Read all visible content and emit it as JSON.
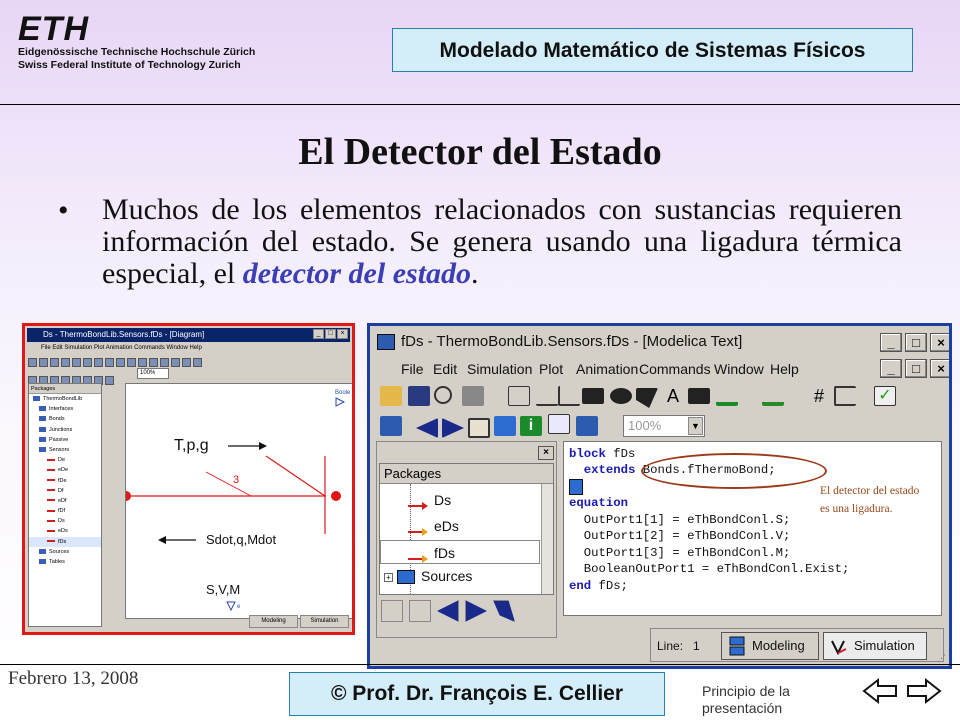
{
  "header": {
    "logo_text": "ETH",
    "logo_line1": "Eidgenössische Technische Hochschule Zürich",
    "logo_line2": "Swiss Federal Institute of Technology Zurich",
    "course_title": "Modelado Matemático de Sistemas Físicos"
  },
  "slide": {
    "title": "El Detector del Estado",
    "bullet": "•",
    "text_before": "Muchos de los elementos relacionados con sustancias requieren información del estado.  Se genera usando una ligadura térmica especial, el ",
    "text_emphasis": "detector del estado",
    "text_after": "."
  },
  "footer": {
    "date": "Febrero 13, 2008",
    "copyright": "© Prof. Dr. François E. Cellier",
    "principio": "Principio de la presentación"
  },
  "diagram_window": {
    "title": "Ds - ThermoBondLib.Sensors.fDs - [Diagram]",
    "menu": [
      "File",
      "Edit",
      "Simulation",
      "Plot",
      "Animation",
      "Commands",
      "Window",
      "Help"
    ],
    "zoom": "100%",
    "packages_header": "Packages",
    "tree": [
      {
        "label": "ThermoBondLib",
        "level": 0
      },
      {
        "label": "Interfaces",
        "level": 1
      },
      {
        "label": "Bonds",
        "level": 1
      },
      {
        "label": "Junctions",
        "level": 1
      },
      {
        "label": "Passive",
        "level": 1
      },
      {
        "label": "Sensors",
        "level": 1
      },
      {
        "label": "De",
        "level": 2
      },
      {
        "label": "eDe",
        "level": 2
      },
      {
        "label": "fDe",
        "level": 2
      },
      {
        "label": "Df",
        "level": 2
      },
      {
        "label": "eDf",
        "level": 2
      },
      {
        "label": "fDf",
        "level": 2
      },
      {
        "label": "Ds",
        "level": 2
      },
      {
        "label": "eDs",
        "level": 2
      },
      {
        "label": "fDs",
        "level": 2,
        "selected": true
      },
      {
        "label": "Sources",
        "level": 1
      },
      {
        "label": "Tables",
        "level": 1
      }
    ],
    "corner_label": "Boole",
    "diagram_labels": {
      "top": "T,p,g",
      "number": "3",
      "middle": "Sdot,q,Mdot",
      "bottom": "S,V,M",
      "small": "e"
    },
    "tabs": [
      "Modeling",
      "Simulation"
    ]
  },
  "modelica_window": {
    "title": "fDs - ThermoBondLib.Sensors.fDs - [Modelica Text]",
    "menu": [
      "File",
      "Edit",
      "Simulation",
      "Plot",
      "Animation",
      "Commands",
      "Window",
      "Help"
    ],
    "zoom": "100%",
    "packages_header": "Packages",
    "tree": [
      {
        "label": "Ds"
      },
      {
        "label": "eDs"
      },
      {
        "label": "fDs",
        "selected": true
      },
      {
        "label": "Sources"
      }
    ],
    "code": [
      {
        "kw": "block",
        "rest": " fDs"
      },
      {
        "kw": "  extends",
        "rest": " Bonds.fThermoBond;"
      },
      {
        "kw": "",
        "rest": ""
      },
      {
        "kw": "equation",
        "rest": ""
      },
      {
        "kw": "",
        "rest": "  OutPort1[1] = eThBondConl.S;"
      },
      {
        "kw": "",
        "rest": "  OutPort1[2] = eThBondConl.V;"
      },
      {
        "kw": "",
        "rest": "  OutPort1[3] = eThBondConl.M;"
      },
      {
        "kw": "",
        "rest": "  BooleanOutPort1 = eThBondConl.Exist;"
      },
      {
        "kw": "end",
        "rest": " fDs;"
      }
    ],
    "annotation": "El detector del estado es una ligadura.",
    "status_line_label": "Line:",
    "status_line_value": "1",
    "tabs": [
      "Modeling",
      "Simulation"
    ]
  },
  "colors": {
    "accent_blue": "#3b3fb6",
    "note_brown": "#9a4a1a",
    "left_frame": "#e01818",
    "right_frame": "#1a3fa0"
  }
}
